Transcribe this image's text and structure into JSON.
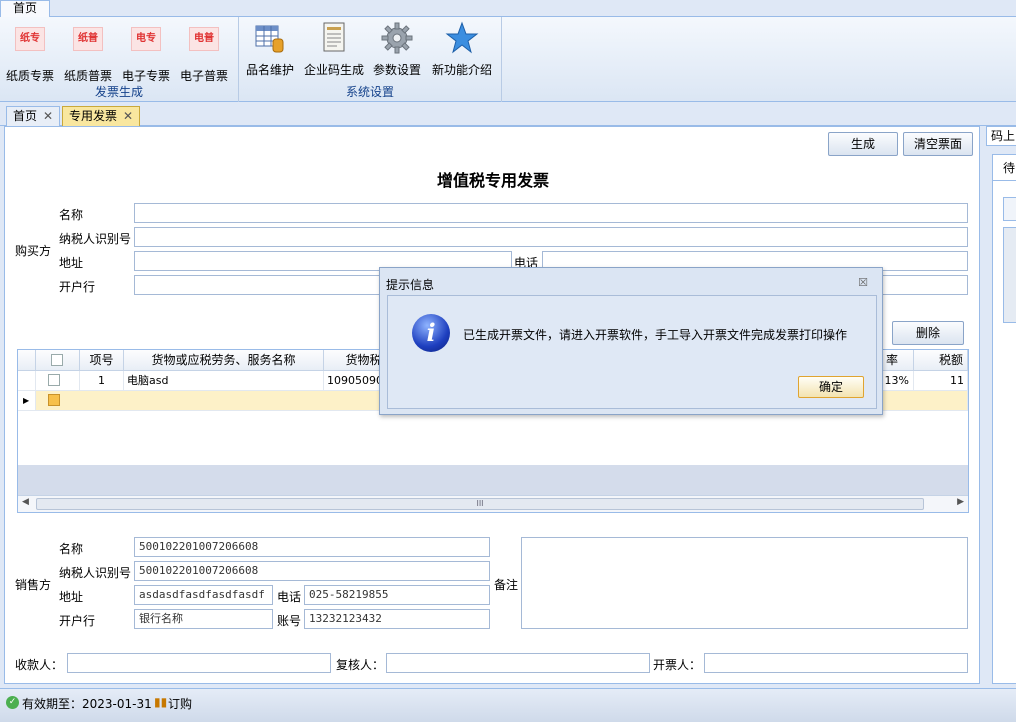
{
  "ribbon": {
    "tab_label": "首页",
    "groups": [
      {
        "label": "发票生成",
        "buttons": [
          {
            "label": "纸质专票",
            "icon": "纸专"
          },
          {
            "label": "纸质普票",
            "icon": "纸普"
          },
          {
            "label": "电子专票",
            "icon": "电专"
          },
          {
            "label": "电子普票",
            "icon": "电普"
          }
        ]
      },
      {
        "label": "系统设置",
        "buttons": [
          {
            "label": "品名维护",
            "icon": "table-db-icon"
          },
          {
            "label": "企业码生成",
            "icon": "document-icon"
          },
          {
            "label": "参数设置",
            "icon": "gear-icon"
          },
          {
            "label": "新功能介绍",
            "icon": "star-icon"
          }
        ]
      }
    ]
  },
  "doc_tabs": [
    {
      "label": "首页",
      "close": "✕"
    },
    {
      "label": "专用发票",
      "close": "✕"
    }
  ],
  "side": {
    "tab_label": "码上",
    "inner_tab": "待"
  },
  "main": {
    "generate_label": "生成",
    "clear_label": "清空票面",
    "title": "增值税专用发票",
    "delete_label": "删除",
    "buyer": {
      "section_label": "购买方",
      "name_label": "名称",
      "taxid_label": "纳税人识别号",
      "address_label": "地址",
      "phone_label": "电话",
      "bank_label": "开户行",
      "name": "",
      "taxid": "",
      "address": "",
      "phone": "",
      "bank": ""
    },
    "grid": {
      "headers": [
        "项号",
        "货物或应税劳务、服务名称",
        "货物税",
        "率",
        "税额"
      ],
      "rows": [
        {
          "index": "1",
          "name": "电脑asd",
          "code": "109050901",
          "rate": "13%",
          "tax": "11"
        }
      ],
      "scroll_label": "III"
    },
    "seller": {
      "section_label": "销售方",
      "name_label": "名称",
      "taxid_label": "纳税人识别号",
      "address_label": "地址",
      "phone_label": "电话",
      "bank_label": "开户行",
      "account_label": "账号",
      "name": "500102201007206608",
      "taxid": "500102201007206608",
      "address": "asdasdfasdfasdfasdf",
      "phone": "025-58219855",
      "bank": "银行名称",
      "account": "13232123432"
    },
    "remark_label": "备注",
    "payee_label": "收款人：",
    "reviewer_label": "复核人：",
    "drawer_label": "开票人："
  },
  "dialog": {
    "title": "提示信息",
    "close": "☒",
    "message": "已生成开票文件，请进入开票软件，手工导入开票文件完成发票打印操作",
    "ok_label": "确定",
    "icon": "i"
  },
  "status": {
    "ok_icon": "✓",
    "expiry": "有效期至：2023-01-31",
    "cart_icon": "▮▮",
    "order_label": "订购"
  }
}
